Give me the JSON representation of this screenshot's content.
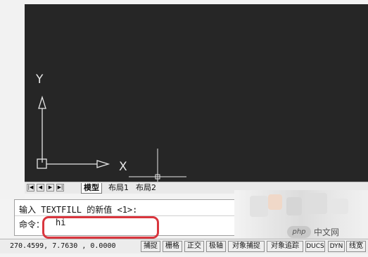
{
  "canvas": {
    "axis_y_label": "Y",
    "axis_x_label": "X",
    "background": "#262626",
    "axis_color": "#e6e6e6"
  },
  "tabs": {
    "nav": [
      "first",
      "prev",
      "next",
      "last"
    ],
    "model": "模型",
    "layout1": "布局1",
    "layout2": "布局2"
  },
  "command": {
    "line1": "输入 TEXTFILL 的新值 <1>:",
    "prompt": "命令：",
    "input": "hi",
    "highlight_color": "#d9363e"
  },
  "status": {
    "coords": "270.4599,  7.7630 , 0.0000",
    "buttons": [
      "捕捉",
      "栅格",
      "正交",
      "极轴",
      "对象捕捉",
      "对象追踪",
      "DUCS",
      "DYN",
      "线宽"
    ]
  },
  "watermark": {
    "logo": "php",
    "text": "中文网"
  }
}
